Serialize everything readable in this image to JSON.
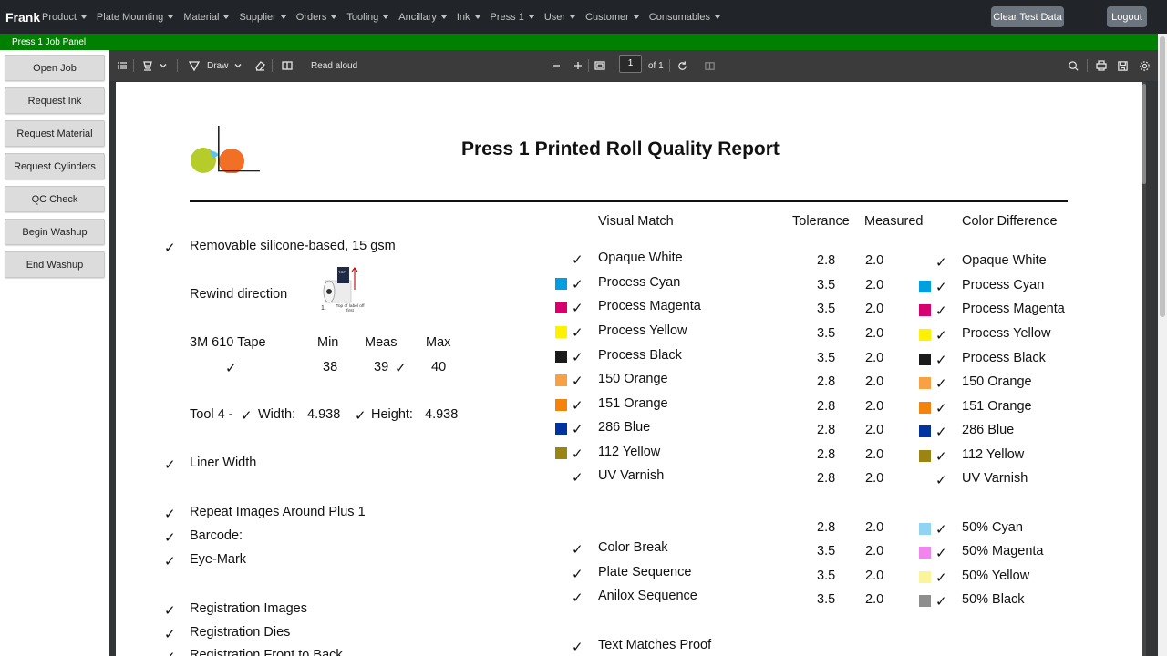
{
  "navbar": {
    "brand": "Frank",
    "items": [
      "Product",
      "Plate Mounting",
      "Material",
      "Supplier",
      "Orders",
      "Tooling",
      "Ancillary",
      "Ink",
      "Press 1",
      "User",
      "Customer",
      "Consumables"
    ],
    "clear_label": "Clear Test Data",
    "logout_label": "Logout"
  },
  "job_bar": {
    "label": "Press 1 Job Panel"
  },
  "sidebar": {
    "buttons": [
      "Open Job",
      "Request Ink",
      "Request Material",
      "Request Cylinders",
      "QC Check",
      "Begin Washup",
      "End Washup"
    ]
  },
  "pdf_toolbar": {
    "draw_label": "Draw",
    "read_aloud_label": "Read aloud",
    "page_value": "1",
    "page_total": "of 1"
  },
  "report": {
    "title": "Press 1 Printed Roll Quality Report",
    "check": "✓",
    "left": {
      "liner": "Removable silicone-based, 15 gsm",
      "rewind_label": "Rewind direction",
      "rewind_fig": {
        "num": "1.",
        "caption": "Top of label off first",
        "tag": "TOP"
      },
      "tape": {
        "label": "3M 610 Tape",
        "min_h": "Min",
        "meas_h": "Meas",
        "max_h": "Max",
        "min": "38",
        "meas": "39",
        "max": "40"
      },
      "tool": {
        "label": "Tool 4 -",
        "width_label": "Width:",
        "width": "4.938",
        "height_label": "Height:",
        "height": "4.938"
      },
      "liner_width": "Liner Width",
      "repeat": "Repeat Images Around Plus 1",
      "barcode": "Barcode:",
      "eyemark": "Eye-Mark",
      "reg_images": "Registration Images",
      "reg_dies": "Registration Dies",
      "reg_front": "Registration Front to Back"
    },
    "headers": {
      "visual": "Visual Match",
      "tolerance": "Tolerance",
      "measured": "Measured",
      "diff": "Color Difference"
    },
    "colors": [
      {
        "name": "Opaque White",
        "color": "",
        "tol": "2.8",
        "meas": "2.0"
      },
      {
        "name": "Process Cyan",
        "color": "#009fdf",
        "tol": "3.5",
        "meas": "2.0"
      },
      {
        "name": "Process Magenta",
        "color": "#d6006e",
        "tol": "3.5",
        "meas": "2.0"
      },
      {
        "name": "Process Yellow",
        "color": "#fff200",
        "tol": "3.5",
        "meas": "2.0"
      },
      {
        "name": "Process Black",
        "color": "#1a1a1a",
        "tol": "3.5",
        "meas": "2.0"
      },
      {
        "name": "150 Orange",
        "color": "#f7a044",
        "tol": "2.8",
        "meas": "2.0"
      },
      {
        "name": "151 Orange",
        "color": "#f5820a",
        "tol": "2.8",
        "meas": "2.0"
      },
      {
        "name": "286 Blue",
        "color": "#0033a0",
        "tol": "2.8",
        "meas": "2.0"
      },
      {
        "name": "112 Yellow",
        "color": "#9c8412",
        "tol": "2.8",
        "meas": "2.0"
      },
      {
        "name": "UV Varnish",
        "color": "",
        "tol": "2.8",
        "meas": "2.0"
      }
    ],
    "tints": [
      {
        "name": "50% Cyan",
        "color": "#8fd4f2",
        "tol": "2.8",
        "meas": "2.0"
      },
      {
        "name": "50% Magenta",
        "color": "#ee86ee",
        "tol": "3.5",
        "meas": "2.0"
      },
      {
        "name": "50% Yellow",
        "color": "#fbf59a",
        "tol": "3.5",
        "meas": "2.0"
      },
      {
        "name": "50% Black",
        "color": "#8e8e8e",
        "tol": "3.5",
        "meas": "2.0"
      }
    ],
    "mid_checks": [
      "Color Break",
      "Plate Sequence",
      "Anilox Sequence"
    ],
    "text_matches": "Text Matches Proof"
  }
}
